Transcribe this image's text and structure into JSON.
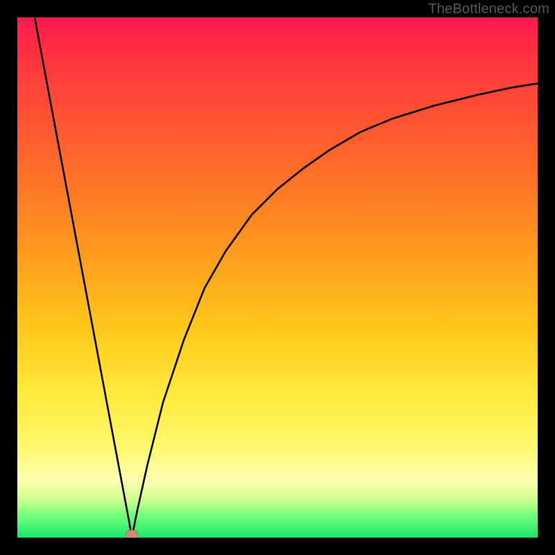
{
  "watermark": "TheBottleneck.com",
  "chart_data": {
    "type": "line",
    "title": "",
    "xlabel": "",
    "ylabel": "",
    "xlim": [
      0,
      100
    ],
    "ylim": [
      0,
      100
    ],
    "note": "Axes are unlabeled; values are estimated from pixel positions on a 0–100 normalized scale. The curve shows a sharp V at x≈22, y≈0 with an asymptotic rise on the right branch.",
    "series": [
      {
        "name": "bottleneck-curve-left",
        "x": [
          3.3,
          5,
          8,
          11,
          14,
          17,
          20,
          21.5,
          22
        ],
        "values": [
          100,
          91,
          75,
          59,
          43,
          27,
          11,
          3,
          0
        ]
      },
      {
        "name": "bottleneck-curve-right",
        "x": [
          22,
          23,
          25,
          28,
          32,
          36,
          40,
          45,
          50,
          55,
          60,
          66,
          72,
          80,
          88,
          95,
          100
        ],
        "values": [
          0,
          5,
          14,
          26,
          38,
          48,
          55,
          62,
          67,
          71,
          74.5,
          78,
          80.5,
          83,
          85,
          86.5,
          87.3
        ]
      }
    ],
    "marker": {
      "x": 22,
      "y": 0,
      "color": "#d98a7a",
      "name": "optimal-point"
    },
    "background_gradient": {
      "stops": [
        {
          "pos": 0.0,
          "color": "#ff1a4d"
        },
        {
          "pos": 0.45,
          "color": "#ff9a1e"
        },
        {
          "pos": 0.82,
          "color": "#fff86a"
        },
        {
          "pos": 1.0,
          "color": "#19e66a"
        }
      ]
    }
  }
}
